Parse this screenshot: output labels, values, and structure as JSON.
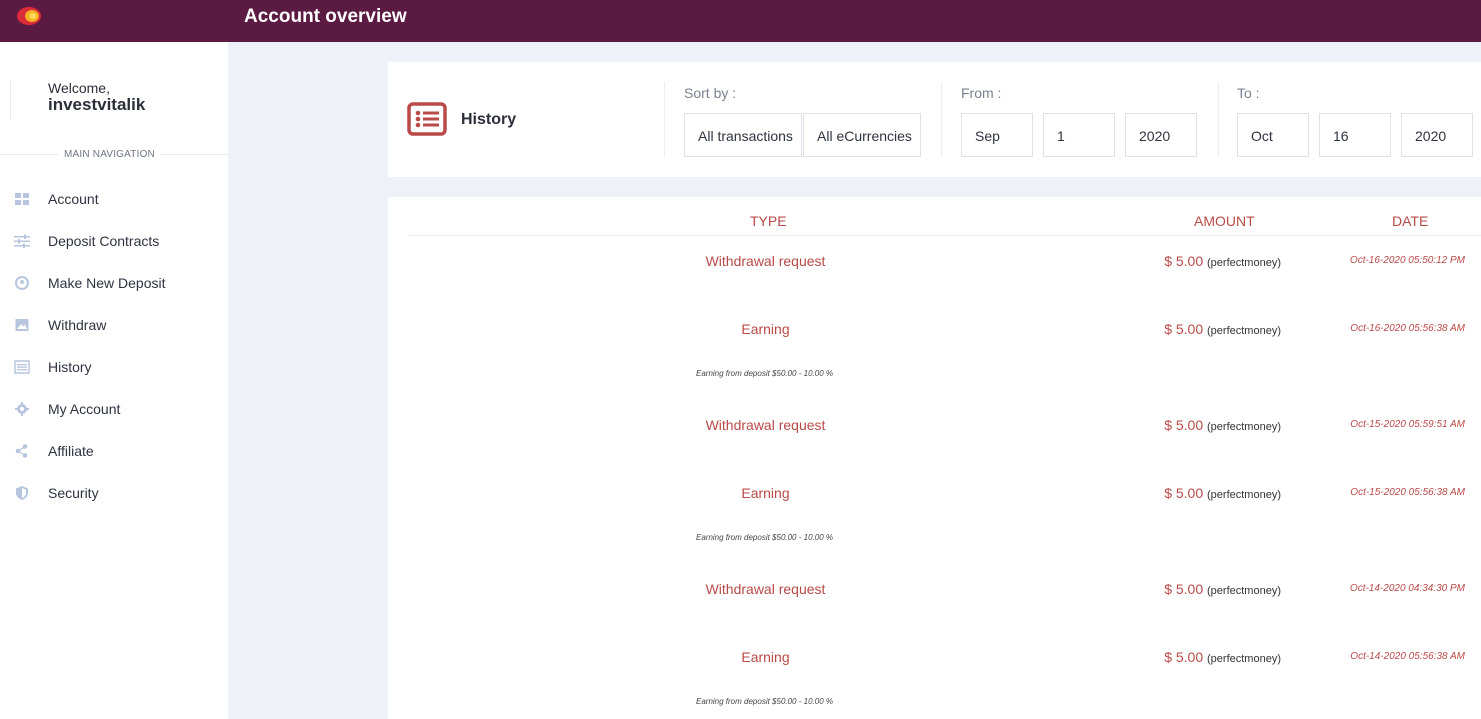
{
  "header": {
    "title": "Account overview"
  },
  "sidebar": {
    "welcome_label": "Welcome,",
    "username": "investvitalik",
    "nav_heading": "MAIN NAVIGATION",
    "items": [
      {
        "label": "Account",
        "icon": "grid-icon"
      },
      {
        "label": "Deposit Contracts",
        "icon": "sliders-icon"
      },
      {
        "label": "Make New Deposit",
        "icon": "coin-icon"
      },
      {
        "label": "Withdraw",
        "icon": "image-icon"
      },
      {
        "label": "History",
        "icon": "list-icon"
      },
      {
        "label": "My Account",
        "icon": "gear-icon"
      },
      {
        "label": "Affiliate",
        "icon": "share-icon"
      },
      {
        "label": "Security",
        "icon": "shield-icon"
      }
    ]
  },
  "filters": {
    "title": "History",
    "sort_label": "Sort by :",
    "sort_type": "All transactions",
    "sort_currency": "All eCurrencies",
    "from_label": "From :",
    "from_month": "Sep",
    "from_day": "1",
    "from_year": "2020",
    "to_label": "To :",
    "to_month": "Oct",
    "to_day": "16",
    "to_year": "2020"
  },
  "table": {
    "headers": {
      "type": "TYPE",
      "amount": "AMOUNT",
      "date": "DATE"
    },
    "rows": [
      {
        "type": "Withdrawal request",
        "amount": "$ 5.00",
        "system": "(perfectmoney)",
        "date": "Oct-16-2020 05:50:12 PM",
        "desc": ""
      },
      {
        "type": "Earning",
        "amount": "$ 5.00",
        "system": "(perfectmoney)",
        "date": "Oct-16-2020 05:56:38 AM",
        "desc": "Earning from deposit $50.00 - 10.00 %"
      },
      {
        "type": "Withdrawal request",
        "amount": "$ 5.00",
        "system": "(perfectmoney)",
        "date": "Oct-15-2020 05:59:51 AM",
        "desc": ""
      },
      {
        "type": "Earning",
        "amount": "$ 5.00",
        "system": "(perfectmoney)",
        "date": "Oct-15-2020 05:56:38 AM",
        "desc": "Earning from deposit $50.00 - 10.00 %"
      },
      {
        "type": "Withdrawal request",
        "amount": "$ 5.00",
        "system": "(perfectmoney)",
        "date": "Oct-14-2020 04:34:30 PM",
        "desc": ""
      },
      {
        "type": "Earning",
        "amount": "$ 5.00",
        "system": "(perfectmoney)",
        "date": "Oct-14-2020 05:56:38 AM",
        "desc": "Earning from deposit $50.00 - 10.00 %"
      }
    ]
  },
  "colors": {
    "header_bg": "#5a1a41",
    "accent": "#b94a48",
    "nav_icon": "#b7c6de"
  }
}
